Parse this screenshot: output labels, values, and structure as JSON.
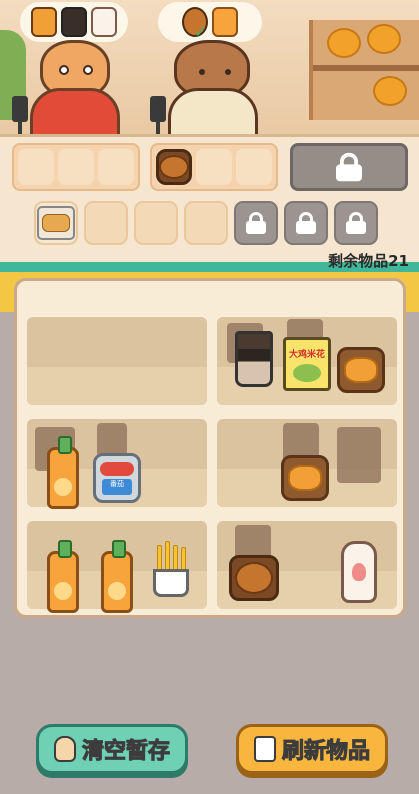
{
  "hud": {
    "remaining_label": "剩余物品21"
  },
  "customers": [
    {
      "name": "cat",
      "wants": [
        "nugget-dish-icon",
        "coffee-cup-icon",
        "mayo-bottle-icon"
      ]
    },
    {
      "name": "capybara",
      "wants": [
        "burger-dish-icon",
        "juice-bottle-icon"
      ],
      "fulfilled": "burger"
    }
  ],
  "chips_label": "大鸡米花",
  "can_label": "番茄",
  "buttons": {
    "clear": "清空暂存",
    "refresh": "刷新物品"
  },
  "colors": {
    "clear_button": "#6fd0b4",
    "refresh_button": "#f8b63f",
    "accent_stripe": "#40b79b"
  }
}
